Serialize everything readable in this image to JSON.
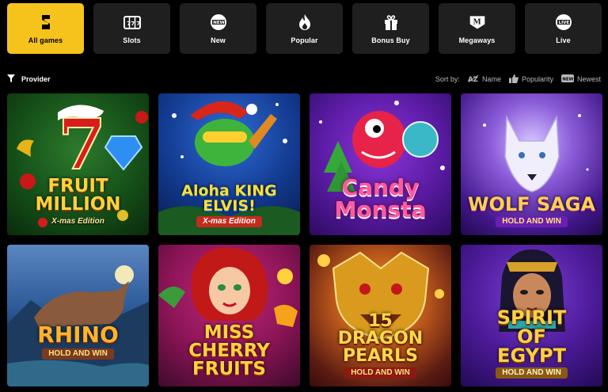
{
  "categories": [
    {
      "label": "All games",
      "icon": "lightning-s-icon",
      "active": true
    },
    {
      "label": "Slots",
      "icon": "slot-machine-icon"
    },
    {
      "label": "New",
      "icon": "new-badge-icon"
    },
    {
      "label": "Popular",
      "icon": "flame-icon"
    },
    {
      "label": "Bonus Buy",
      "icon": "gift-icon"
    },
    {
      "label": "Megaways",
      "icon": "megaways-m-icon"
    },
    {
      "label": "Live",
      "icon": "live-badge-icon"
    }
  ],
  "filter": {
    "provider_label": "Provider",
    "icon": "funnel-icon"
  },
  "sort": {
    "label": "Sort by:",
    "options": [
      {
        "label": "Name",
        "icon": "az-sort-icon"
      },
      {
        "label": "Popularity",
        "icon": "thumbs-up-icon"
      },
      {
        "label": "Newest",
        "icon": "new-badge-icon"
      }
    ]
  },
  "games": [
    {
      "title": "FRUIT MILLION",
      "subtitle": "X-mas Edition"
    },
    {
      "title": "Aloha KING ELVIS!",
      "subtitle": "X-mas Edition"
    },
    {
      "title": "Candy Monsta",
      "subtitle": ""
    },
    {
      "title": "WOLF SAGA",
      "subtitle": "HOLD AND WIN"
    },
    {
      "title": "RHINO",
      "subtitle": "HOLD AND WIN"
    },
    {
      "title": "MISS CHERRY FRUITS",
      "subtitle": ""
    },
    {
      "title": "15 DRAGON PEARLS",
      "subtitle": "HOLD AND WIN"
    },
    {
      "title": "SPIRIT OF EGYPT",
      "subtitle": "HOLD AND WIN"
    }
  ],
  "colors": {
    "accent": "#f6c21c",
    "tile_bg": "#1f1f1f",
    "page_bg": "#000000"
  }
}
